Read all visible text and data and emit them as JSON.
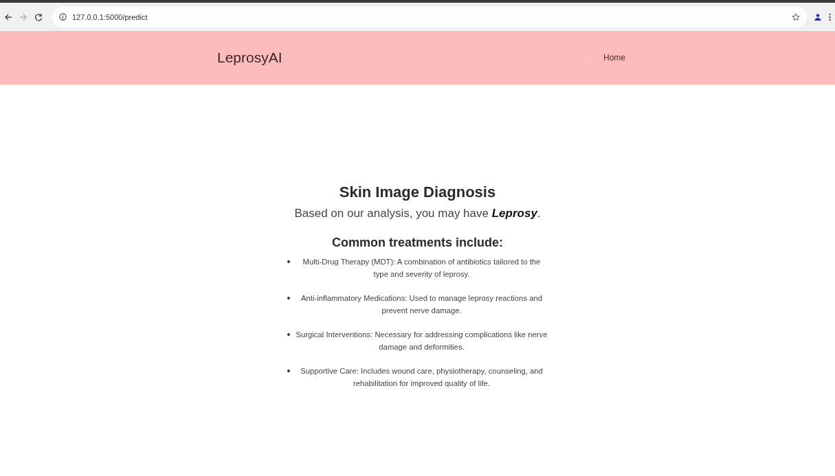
{
  "browser": {
    "url": "127.0.0.1:5000/predict"
  },
  "navbar": {
    "brand": "LeprosyAI",
    "links": [
      {
        "label": "Home"
      }
    ]
  },
  "main": {
    "title": "Skin Image Diagnosis",
    "result": "Based on our analysis, you may have **Leprosy**.",
    "treatments_heading": "Common treatments include:",
    "treatments": [
      "Multi-Drug Therapy (MDT): A combination of antibiotics tailored to the type and severity of leprosy.",
      "Anti-inflammatory Medications: Used to manage leprosy reactions and prevent nerve damage.",
      "Surgical Interventions: Necessary for addressing complications like nerve damage and deformities.",
      "Supportive Care: Includes wound care, physiotherapy, counseling, and rehabilitation for improved quality of life."
    ]
  }
}
